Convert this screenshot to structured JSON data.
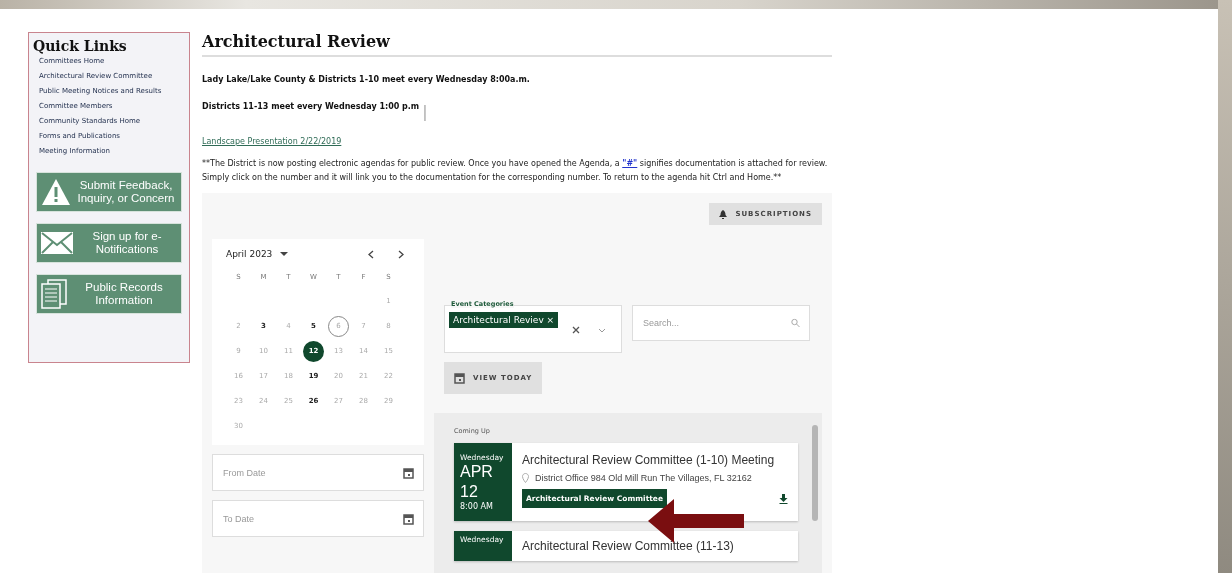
{
  "sidebar": {
    "title": "Quick Links",
    "links": [
      "Committees Home",
      "Architectural Review Committee",
      "Public Meeting Notices and Results",
      "Committee Members",
      "Community Standards Home",
      "Forms and Publications",
      "Meeting Information"
    ],
    "tiles": [
      {
        "kind": "warning",
        "label": "Submit Feedback, Inquiry, or Concern"
      },
      {
        "kind": "mail",
        "label": "Sign up for e-Notifications"
      },
      {
        "kind": "documents",
        "label": "Public Records Information"
      }
    ]
  },
  "page": {
    "title": "Architectural Review",
    "schedule": [
      "Lady Lake/Lake County & Districts 1-10 meet every Wednesday 8:00a.m.",
      "Districts 11-13 meet every Wednesday 1:00 p.m"
    ],
    "separator": "|",
    "link": "Landscape Presentation 2/22/2019",
    "notice_before": "**The District is now posting electronic agendas for public review.  Once you have opened the Agenda, a ",
    "notice_link": "\"#\"",
    "notice_after": " signifies documentation is attached for review.  Simply click on the number and it will link you to the documentation for the corresponding number.  To return to the agenda hit Ctrl and Home.**"
  },
  "calendar": {
    "subscriptions": "SUBSCRIPTIONS",
    "month": "April 2023",
    "weekdays": [
      "S",
      "M",
      "T",
      "W",
      "T",
      "F",
      "S"
    ],
    "weeks": [
      [
        {
          "day": "1",
          "has_events": false,
          "today": false,
          "selected": false
        }
      ],
      [
        {
          "day": "2",
          "has_events": false,
          "today": false,
          "selected": false
        },
        {
          "day": "3",
          "has_events": true,
          "today": false,
          "selected": false
        },
        {
          "day": "4",
          "has_events": false,
          "today": false,
          "selected": false
        },
        {
          "day": "5",
          "has_events": true,
          "today": false,
          "selected": false
        },
        {
          "day": "6",
          "has_events": false,
          "today": true,
          "selected": false
        },
        {
          "day": "7",
          "has_events": false,
          "today": false,
          "selected": false
        },
        {
          "day": "8",
          "has_events": false,
          "today": false,
          "selected": false
        }
      ],
      [
        {
          "day": "9",
          "has_events": false,
          "today": false,
          "selected": false
        },
        {
          "day": "10",
          "has_events": false,
          "today": false,
          "selected": false
        },
        {
          "day": "11",
          "has_events": false,
          "today": false,
          "selected": false
        },
        {
          "day": "12",
          "has_events": true,
          "today": false,
          "selected": true
        },
        {
          "day": "13",
          "has_events": false,
          "today": false,
          "selected": false
        },
        {
          "day": "14",
          "has_events": false,
          "today": false,
          "selected": false
        },
        {
          "day": "15",
          "has_events": false,
          "today": false,
          "selected": false
        }
      ],
      [
        {
          "day": "16",
          "has_events": false,
          "today": false,
          "selected": false
        },
        {
          "day": "17",
          "has_events": false,
          "today": false,
          "selected": false
        },
        {
          "day": "18",
          "has_events": false,
          "today": false,
          "selected": false
        },
        {
          "day": "19",
          "has_events": true,
          "today": false,
          "selected": false
        },
        {
          "day": "20",
          "has_events": false,
          "today": false,
          "selected": false
        },
        {
          "day": "21",
          "has_events": false,
          "today": false,
          "selected": false
        },
        {
          "day": "22",
          "has_events": false,
          "today": false,
          "selected": false
        }
      ],
      [
        {
          "day": "23",
          "has_events": false,
          "today": false,
          "selected": false
        },
        {
          "day": "24",
          "has_events": false,
          "today": false,
          "selected": false
        },
        {
          "day": "25",
          "has_events": false,
          "today": false,
          "selected": false
        },
        {
          "day": "26",
          "has_events": true,
          "today": false,
          "selected": false
        },
        {
          "day": "27",
          "has_events": false,
          "today": false,
          "selected": false
        },
        {
          "day": "28",
          "has_events": false,
          "today": false,
          "selected": false
        },
        {
          "day": "29",
          "has_events": false,
          "today": false,
          "selected": false
        }
      ],
      [
        {
          "day": "30",
          "has_events": false,
          "today": false,
          "selected": false
        }
      ]
    ],
    "from_date": {
      "placeholder": "From Date"
    },
    "to_date": {
      "placeholder": "To Date"
    },
    "categories_label": "Event Categories",
    "category_chip": "Architectural Reviev",
    "chip_remove": "×",
    "search": {
      "placeholder": "Search..."
    },
    "view_today": "VIEW TODAY",
    "section": "Coming Up",
    "events": [
      {
        "weekday": "Wednesday",
        "month": "APR",
        "day": "12",
        "time": "8:00 AM",
        "title": "Architectural Review Committee (1-10) Meeting",
        "location": "District Office 984 Old Mill Run The Villages, FL 32162",
        "tag": "Architectural Review Committee"
      },
      {
        "weekday": "Wednesday",
        "title": "Architectural Review Committee (11-13)"
      }
    ]
  }
}
